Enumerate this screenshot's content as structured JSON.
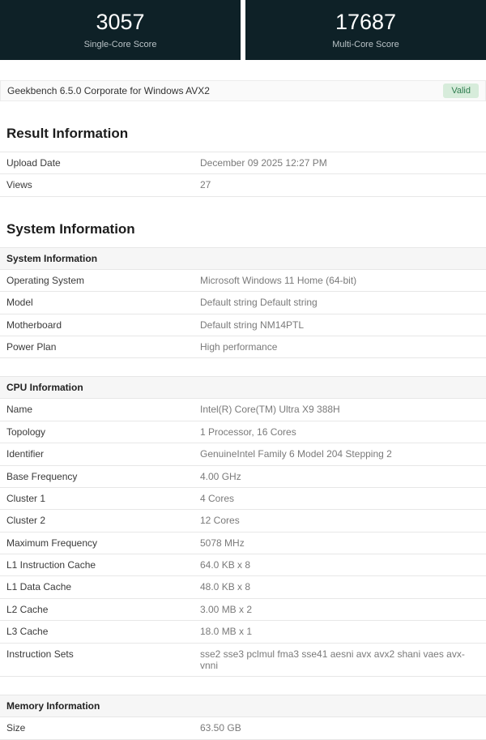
{
  "scores": {
    "single": {
      "value": "3057",
      "label": "Single-Core Score"
    },
    "multi": {
      "value": "17687",
      "label": "Multi-Core Score"
    }
  },
  "header": {
    "title": "Geekbench 6.5.0 Corporate for Windows AVX2",
    "badge": "Valid"
  },
  "sections": [
    {
      "title": "Result Information",
      "tables": [
        {
          "header": null,
          "rows": [
            {
              "label": "Upload Date",
              "value": "December 09 2025 12:27 PM"
            },
            {
              "label": "Views",
              "value": "27"
            }
          ]
        }
      ]
    },
    {
      "title": "System Information",
      "tables": [
        {
          "header": "System Information",
          "rows": [
            {
              "label": "Operating System",
              "value": "Microsoft Windows 11 Home (64-bit)"
            },
            {
              "label": "Model",
              "value": "Default string Default string"
            },
            {
              "label": "Motherboard",
              "value": "Default string NM14PTL"
            },
            {
              "label": "Power Plan",
              "value": "High performance"
            }
          ]
        },
        {
          "header": "CPU Information",
          "rows": [
            {
              "label": "Name",
              "value": "Intel(R) Core(TM) Ultra X9 388H"
            },
            {
              "label": "Topology",
              "value": "1 Processor, 16 Cores"
            },
            {
              "label": "Identifier",
              "value": "GenuineIntel Family 6 Model 204 Stepping 2"
            },
            {
              "label": "Base Frequency",
              "value": "4.00 GHz"
            },
            {
              "label": "Cluster 1",
              "value": "4 Cores"
            },
            {
              "label": "Cluster 2",
              "value": "12 Cores"
            },
            {
              "label": "Maximum Frequency",
              "value": "5078 MHz"
            },
            {
              "label": "L1 Instruction Cache",
              "value": "64.0 KB x 8"
            },
            {
              "label": "L1 Data Cache",
              "value": "48.0 KB x 8"
            },
            {
              "label": "L2 Cache",
              "value": "3.00 MB x 2"
            },
            {
              "label": "L3 Cache",
              "value": "18.0 MB x 1"
            },
            {
              "label": "Instruction Sets",
              "value": "sse2 sse3 pclmul fma3 sse41 aesni avx avx2 shani vaes avx-vnni"
            }
          ]
        },
        {
          "header": "Memory Information",
          "rows": [
            {
              "label": "Size",
              "value": "63.50 GB"
            }
          ]
        }
      ]
    }
  ],
  "colors": {
    "score_bg": "#0e2127",
    "score_text": "#ffffff",
    "score_label": "#b9c2c6",
    "badge_bg": "#d7ecdb",
    "badge_text": "#2f7d4f",
    "border": "#e7e7e7",
    "subheader_bg": "#f6f6f6",
    "label_text": "#3a3a3a",
    "value_text": "#7a7a7a"
  }
}
